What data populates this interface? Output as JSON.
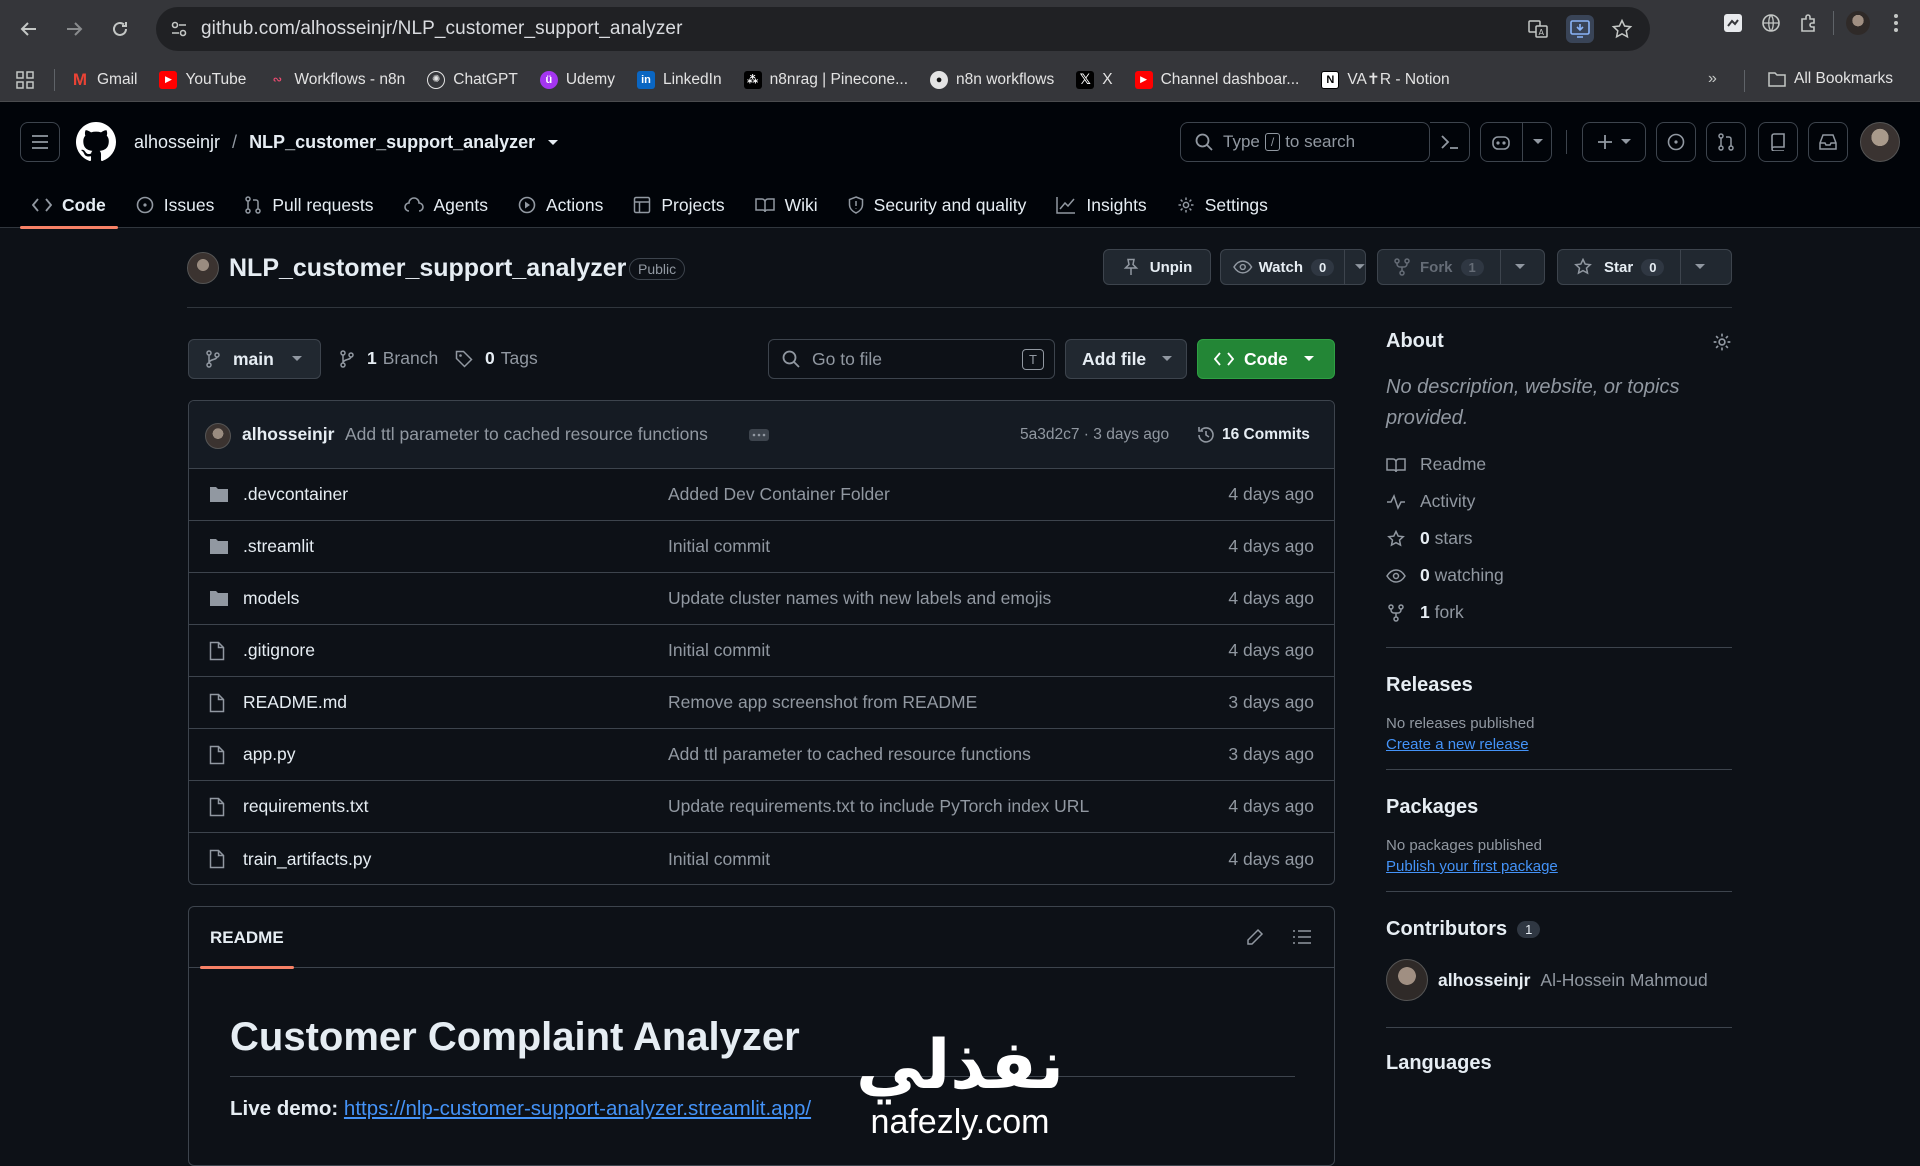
{
  "browser": {
    "url": "github.com/alhosseinjr/NLP_customer_support_analyzer",
    "bookmarks": [
      "Gmail",
      "YouTube",
      "Workflows - n8n",
      "ChatGPT",
      "Udemy",
      "LinkedIn",
      "n8nrag | Pinecone...",
      "n8n workflows",
      "X",
      "Channel dashboar...",
      "VA✝R - Notion"
    ],
    "all_bookmarks": "All Bookmarks"
  },
  "header": {
    "owner": "alhosseinjr",
    "separator": "/",
    "repo": "NLP_customer_support_analyzer",
    "search_type": "Type",
    "search_key": "/",
    "search_rest": "to search"
  },
  "tabs": [
    {
      "label": "Code"
    },
    {
      "label": "Issues"
    },
    {
      "label": "Pull requests"
    },
    {
      "label": "Agents"
    },
    {
      "label": "Actions"
    },
    {
      "label": "Projects"
    },
    {
      "label": "Wiki"
    },
    {
      "label": "Security and quality"
    },
    {
      "label": "Insights"
    },
    {
      "label": "Settings"
    }
  ],
  "repo": {
    "name": "NLP_customer_support_analyzer",
    "visibility": "Public",
    "unpin": "Unpin",
    "watch": "Watch",
    "watch_count": "0",
    "fork": "Fork",
    "fork_count": "1",
    "star": "Star",
    "star_count": "0"
  },
  "toolbar": {
    "branch": "main",
    "branches_count": "1",
    "branches_label": "Branch",
    "tags_count": "0",
    "tags_label": "Tags",
    "go_to_file": "Go to file",
    "go_to_file_key": "T",
    "add_file": "Add file",
    "code": "Code"
  },
  "latest_commit": {
    "author": "alhosseinjr",
    "message": "Add ttl parameter to cached resource functions",
    "hash": "5a3d2c7",
    "dot": "·",
    "time": "3 days ago",
    "commits": "16 Commits"
  },
  "files": [
    {
      "type": "folder",
      "name": ".devcontainer",
      "message": "Added Dev Container Folder",
      "date": "4 days ago"
    },
    {
      "type": "folder",
      "name": ".streamlit",
      "message": "Initial commit",
      "date": "4 days ago"
    },
    {
      "type": "folder",
      "name": "models",
      "message": "Update cluster names with new labels and emojis",
      "date": "4 days ago"
    },
    {
      "type": "file",
      "name": ".gitignore",
      "message": "Initial commit",
      "date": "4 days ago"
    },
    {
      "type": "file",
      "name": "README.md",
      "message": "Remove app screenshot from README",
      "date": "3 days ago"
    },
    {
      "type": "file",
      "name": "app.py",
      "message": "Add ttl parameter to cached resource functions",
      "date": "3 days ago"
    },
    {
      "type": "file",
      "name": "requirements.txt",
      "message": "Update requirements.txt to include PyTorch index URL",
      "date": "4 days ago"
    },
    {
      "type": "file",
      "name": "train_artifacts.py",
      "message": "Initial commit",
      "date": "4 days ago"
    }
  ],
  "readme": {
    "tab": "README",
    "title": "Customer Complaint Analyzer",
    "live_label": "Live demo:",
    "live_url": "https://nlp-customer-support-analyzer.streamlit.app/"
  },
  "about": {
    "title": "About",
    "description": "No description, website, or topics provided.",
    "readme": "Readme",
    "activity": "Activity",
    "stars_count": "0",
    "stars_label": "stars",
    "watching_count": "0",
    "watching_label": "watching",
    "forks_count": "1",
    "forks_label": "fork"
  },
  "releases": {
    "title": "Releases",
    "none": "No releases published",
    "link": "Create a new release"
  },
  "packages": {
    "title": "Packages",
    "none": "No packages published",
    "link": "Publish your first package"
  },
  "contributors": {
    "title": "Contributors",
    "count": "1",
    "login": "alhosseinjr",
    "name": "Al-Hossein Mahmoud"
  },
  "languages": {
    "title": "Languages"
  },
  "watermark": {
    "arabic": "نفذلي",
    "latin": "nafezly.com"
  }
}
